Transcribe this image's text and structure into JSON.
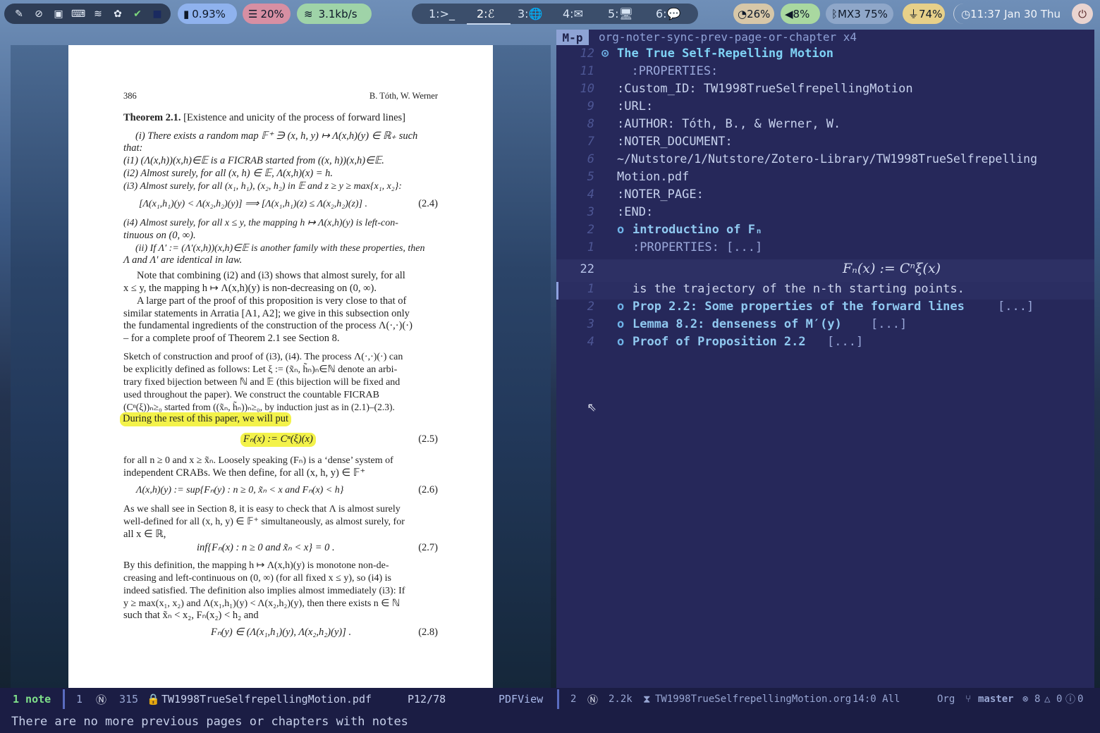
{
  "topbar": {
    "cpu": "0.93%",
    "mem": "20%",
    "net": "3.1kb/s",
    "workspaces": [
      {
        "id": "1",
        "label": "1:",
        "icon": ">_"
      },
      {
        "id": "2",
        "label": "2:",
        "icon": "ℰ"
      },
      {
        "id": "3",
        "label": "3:",
        "icon": "🌐"
      },
      {
        "id": "4",
        "label": "4:",
        "icon": "✉"
      },
      {
        "id": "5",
        "label": "5:",
        "icon": "🖥"
      },
      {
        "id": "6",
        "label": "6:",
        "icon": "💬"
      }
    ],
    "battery": "26%",
    "volume": "8%",
    "bluetooth": "MX3 75%",
    "power": "74%",
    "clock": "11:37 Jan 30 Thu"
  },
  "pdf": {
    "header_page": "386",
    "header_authors": "B. Tóth, W. Werner",
    "theorem_title": "Theorem 2.1.",
    "theorem_name": "[Existence and unicity of the process of forward lines]",
    "i_line1": "(i) There exists a random map 𝔽⁺ ∋ (x, h, y) ↦ Λ(x,h)(y) ∈ ℝ₊ such",
    "i_line2": "that:",
    "i1": "(i1) (Λ(x,h))(x,h)∈𝔼 is a FICRAB started from ((x, h))(x,h)∈𝔼.",
    "i2": "(i2) Almost surely, for all (x, h) ∈ 𝔼, Λ(x,h)(x) = h.",
    "i3": "(i3) Almost surely, for all (x₁, h₁), (x₂, h₂) in 𝔼 and z ≥ y ≥ max{x₁, x₂}:",
    "eq24": "[Λ(x₁,h₁)(y) < Λ(x₂,h₂)(y)]    ⟹    [Λ(x₁,h₁)(z) ≤ Λ(x₂,h₂)(z)]  .",
    "eq24_no": "(2.4)",
    "i4_line1": "(i4) Almost surely, for all x ≤ y, the mapping h ↦ Λ(x,h)(y) is left-con-",
    "i4_line2": "tinuous on (0, ∞).",
    "ii_line1": "(ii) If Λ′ := (Λ′(x,h))(x,h)∈𝔼 is another family with these properties, then",
    "ii_line2": "Λ and Λ′ are identical in law.",
    "p1": [
      "Note that combining (i2) and (i3) shows that almost surely, for all",
      "x ≤ y, the mapping h ↦ Λ(x,h)(y) is non-decreasing on (0, ∞).",
      "A large part of the proof of this proposition is very close to that of",
      "similar statements in Arratia [A1, A2]; we give in this subsection only",
      "the fundamental ingredients of the construction of the process Λ(·,·)(·)",
      "– for a complete proof of Theorem 2.1 see Section 8."
    ],
    "p2": [
      "Sketch of construction and proof of (i3), (i4). The process Λ(·,·)(·) can",
      "be explicitly defined as follows: Let ξ := (x̃ₙ, h̃ₙ)ₙ∈ℕ denote an arbi-",
      "trary fixed bijection between ℕ and 𝔼 (this bijection will be fixed and",
      "used throughout the paper). We construct the countable FICRAB",
      "(Cⁿ(ξ))ₙ≥₀ started from ((x̃ₙ, h̃ₙ))ₙ≥₀, by induction just as in (2.1)–(2.3)."
    ],
    "highlight1": "During the rest of this paper, we will put",
    "eq25": "Fₙ(x) := Cⁿ(ξ)(x)",
    "eq25_no": "(2.5)",
    "p3": [
      "for all n ≥ 0 and x ≥ x̃ₙ. Loosely speaking (Fₙ) is a ‘dense’ system of",
      "independent CRABs. We then define, for all (x, h, y) ∈ 𝔽⁺"
    ],
    "eq26": "Λ(x,h)(y) := sup{Fₙ(y) :  n ≥ 0,   x̃ₙ < x    and    Fₙ(x) < h}",
    "eq26_no": "(2.6)",
    "p4": [
      "As we shall see in Section 8, it is easy to check that Λ is almost surely",
      "well-defined for all (x, h, y) ∈ 𝔽⁺ simultaneously, as almost surely, for",
      "all x ∈ ℝ,"
    ],
    "eq27": "inf{Fₙ(x) :  n ≥ 0  and  x̃ₙ < x} = 0  .",
    "eq27_no": "(2.7)",
    "p5": [
      "By this definition, the mapping h ↦ Λ(x,h)(y) is monotone non-de-",
      "creasing and left-continuous on (0, ∞) (for all fixed x ≤ y), so (i4) is",
      "indeed satisfied. The definition also implies almost immediately (i3): If",
      "y ≥ max(x₁, x₂) and Λ(x₁,h₁)(y) < Λ(x₂,h₂)(y), then there exists n ∈ ℕ",
      "such that x̃ₙ < x₂, Fₙ(x₂) < h₂ and"
    ],
    "eq28": "Fₙ(y) ∈ (Λ(x₁,h₁)(y), Λ(x₂,h₂)(y)]  .",
    "eq28_no": "(2.8)"
  },
  "emacs": {
    "key": "M-p",
    "command": "org-noter-sync-prev-page-or-chapter x4",
    "lines": [
      {
        "num": "12",
        "bullet": "⊙",
        "text": "The True Self-Repelling Motion",
        "style": "h1"
      },
      {
        "num": "11",
        "bullet": "",
        "text": "  :PROPERTIES:",
        "style": "prop"
      },
      {
        "num": "10",
        "bullet": "",
        "text": ":Custom_ID: TW1998TrueSelfrepellingMotion",
        "style": "plain"
      },
      {
        "num": "9",
        "bullet": "",
        "text": ":URL:",
        "style": "plain"
      },
      {
        "num": "8",
        "bullet": "",
        "text": ":AUTHOR: Tóth, B., & Werner, W.",
        "style": "plain"
      },
      {
        "num": "7",
        "bullet": "",
        "text": ":NOTER_DOCUMENT:",
        "style": "plain"
      },
      {
        "num": "6",
        "bullet": "",
        "text": "~/Nutstore/1/Nutstore/Zotero-Library/TW1998TrueSelfrepelling",
        "style": "plain"
      },
      {
        "num": "5",
        "bullet": "",
        "text": "Motion.pdf",
        "style": "plain"
      },
      {
        "num": "4",
        "bullet": "",
        "text": ":NOTER_PAGE:",
        "style": "plain"
      },
      {
        "num": "3",
        "bullet": "",
        "text": ":END:",
        "style": "plain"
      },
      {
        "num": "2",
        "bullet": "o",
        "text": "introductino of Fₙ",
        "style": "h2"
      },
      {
        "num": "1",
        "bullet": "",
        "text": ":PROPERTIES: [...]",
        "style": "prop"
      }
    ],
    "current_num": "22",
    "formula": "Fₙ(x) := Cⁿξ(x)",
    "after": [
      {
        "num": "1",
        "bullet": "",
        "text": "is the trajectory of the n-th starting points.",
        "style": "plain"
      },
      {
        "num": "2",
        "bullet": "o",
        "text": "Prop 2.2: Some properties of the forward lines",
        "ell": "[...]",
        "style": "h2"
      },
      {
        "num": "3",
        "bullet": "o",
        "text": "Lemma 8.2: denseness of M′(y)",
        "ell": "[...]",
        "style": "h2"
      },
      {
        "num": "4",
        "bullet": "o",
        "text": "Proof of Proposition 2.2",
        "ell": "[...]",
        "style": "h2"
      }
    ]
  },
  "modeline": {
    "left_notes": "1 note",
    "left_win": "1",
    "left_size": "315",
    "left_file": "TW1998TrueSelfrepellingMotion.pdf",
    "left_page": "P12/78",
    "left_mode": "PDFView",
    "right_win": "2",
    "right_size": "2.2k",
    "right_file": "TW1998TrueSelfrepellingMotion.org",
    "right_pos": "14:0 All",
    "right_mode": "Org",
    "right_branch": "master",
    "right_err": "8",
    "right_warn": "0",
    "right_info": "0"
  },
  "echo": "There are no more previous pages or chapters with notes"
}
